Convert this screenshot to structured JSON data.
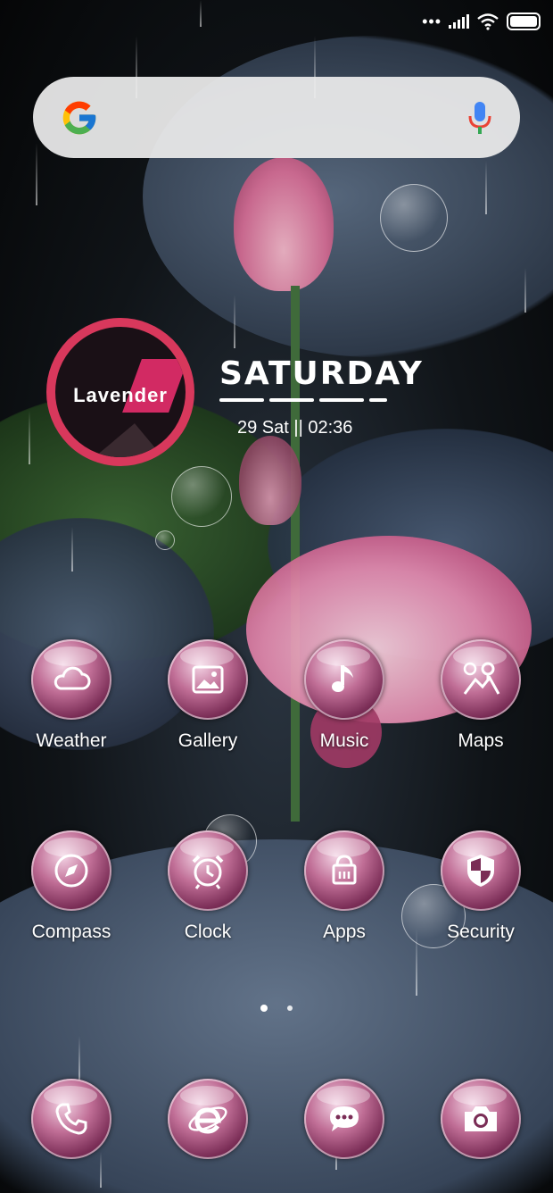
{
  "status_bar": {
    "icons": [
      "more-dots-icon",
      "signal-icon",
      "wifi-icon",
      "battery-icon"
    ]
  },
  "search_bar": {
    "logo": "google-logo-icon",
    "mic": "mic-icon"
  },
  "clock_widget": {
    "brand": "Lavender",
    "day": "SATURDAY",
    "datetime": "29 Sat || 02:36",
    "ring_color": "#d8385c"
  },
  "home_apps": [
    {
      "label": "Weather",
      "icon": "cloud-icon"
    },
    {
      "label": "Gallery",
      "icon": "image-icon"
    },
    {
      "label": "Music",
      "icon": "music-note-icon"
    },
    {
      "label": "Maps",
      "icon": "map-pin-icon"
    },
    {
      "label": "Compass",
      "icon": "compass-icon"
    },
    {
      "label": "Clock",
      "icon": "alarm-clock-icon"
    },
    {
      "label": "Apps",
      "icon": "shopping-bag-icon"
    },
    {
      "label": "Security",
      "icon": "shield-icon"
    }
  ],
  "pager": {
    "pages": 2,
    "current": 1
  },
  "dock": [
    {
      "icon": "phone-icon"
    },
    {
      "icon": "browser-e-icon"
    },
    {
      "icon": "chat-bubble-icon"
    },
    {
      "icon": "camera-icon"
    }
  ],
  "colors": {
    "accent_pink": "#c06e96",
    "ring": "#d8385c",
    "search_bg": "#ececec"
  }
}
